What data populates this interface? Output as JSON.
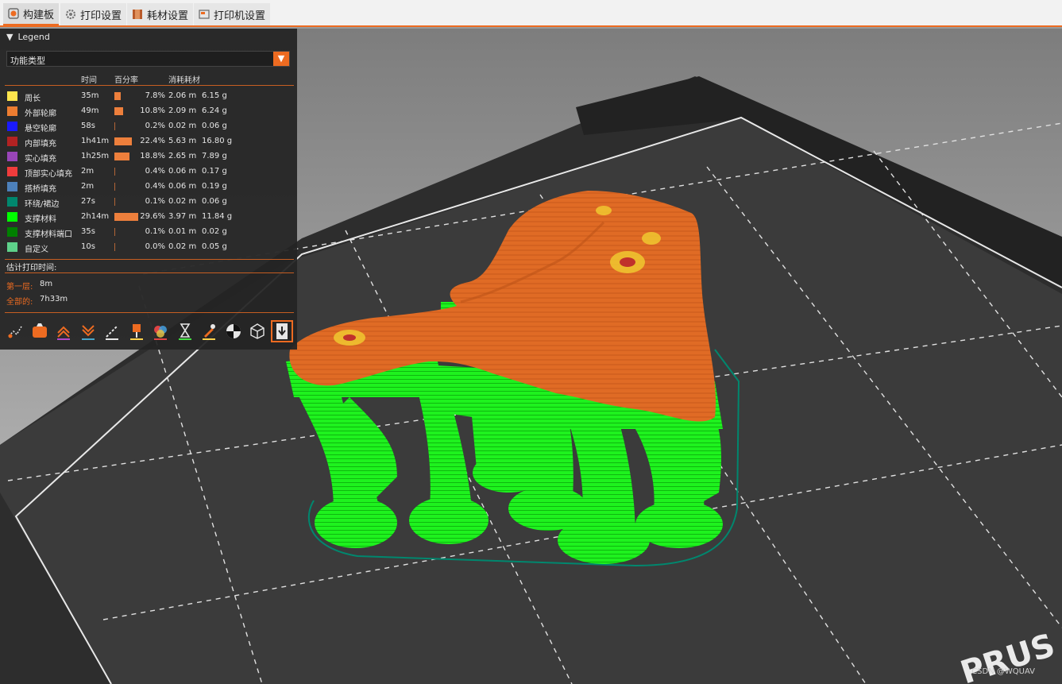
{
  "tabs": [
    {
      "label": "构建板",
      "icon": "plater-icon"
    },
    {
      "label": "打印设置",
      "icon": "print-settings-icon"
    },
    {
      "label": "耗材设置",
      "icon": "filament-icon"
    },
    {
      "label": "打印机设置",
      "icon": "printer-icon"
    }
  ],
  "legend": {
    "title": "Legend",
    "view_type": "功能类型",
    "headers": {
      "time": "时间",
      "percent": "百分率",
      "used": "消耗耗材"
    },
    "items": [
      {
        "name": "周长",
        "time": "35m",
        "percent": "7.8%",
        "length": "2.06 m",
        "weight": "6.15 g",
        "color": "#ffe64d",
        "ratio": 0.078
      },
      {
        "name": "外部轮廓",
        "time": "49m",
        "percent": "10.8%",
        "length": "2.09 m",
        "weight": "6.24 g",
        "color": "#ed7d31",
        "ratio": 0.108
      },
      {
        "name": "悬空轮廓",
        "time": "58s",
        "percent": "0.2%",
        "length": "0.02 m",
        "weight": "0.06 g",
        "color": "#1a1aff",
        "ratio": 0.002
      },
      {
        "name": "内部填充",
        "time": "1h41m",
        "percent": "22.4%",
        "length": "5.63 m",
        "weight": "16.80 g",
        "color": "#b22222",
        "ratio": 0.224
      },
      {
        "name": "实心填充",
        "time": "1h25m",
        "percent": "18.8%",
        "length": "2.65 m",
        "weight": "7.89 g",
        "color": "#9945b8",
        "ratio": 0.188
      },
      {
        "name": "顶部实心填充",
        "time": "2m",
        "percent": "0.4%",
        "length": "0.06 m",
        "weight": "0.17 g",
        "color": "#f03c3c",
        "ratio": 0.004
      },
      {
        "name": "搭桥填充",
        "time": "2m",
        "percent": "0.4%",
        "length": "0.06 m",
        "weight": "0.19 g",
        "color": "#4d80ba",
        "ratio": 0.004
      },
      {
        "name": "环绕/裙边",
        "time": "27s",
        "percent": "0.1%",
        "length": "0.02 m",
        "weight": "0.06 g",
        "color": "#00876e",
        "ratio": 0.001
      },
      {
        "name": "支撑材料",
        "time": "2h14m",
        "percent": "29.6%",
        "length": "3.97 m",
        "weight": "11.84 g",
        "color": "#00ff00",
        "ratio": 0.296
      },
      {
        "name": "支撑材料端口",
        "time": "35s",
        "percent": "0.1%",
        "length": "0.01 m",
        "weight": "0.02 g",
        "color": "#008000",
        "ratio": 0.001
      },
      {
        "name": "自定义",
        "time": "10s",
        "percent": "0.0%",
        "length": "0.02 m",
        "weight": "0.05 g",
        "color": "#5ed18a",
        "ratio": 0.0
      }
    ],
    "estimate_title": "估计打印时间:",
    "first_layer_label": "第一层:",
    "first_layer_value": "8m",
    "total_label": "全部的:",
    "total_value": "7h33m"
  },
  "toolbar_icons": [
    "travel-icon",
    "wipe-icon",
    "retractions-icon",
    "deretractions-icon",
    "seams-icon",
    "tool-changes-icon",
    "color-changes-icon",
    "pause-prints-icon",
    "custom-gcodes-icon",
    "center-of-gravity-icon",
    "shells-icon",
    "tool-marker-icon"
  ],
  "watermark": "CSDN @WQUAV",
  "bed_label": "PRUS"
}
